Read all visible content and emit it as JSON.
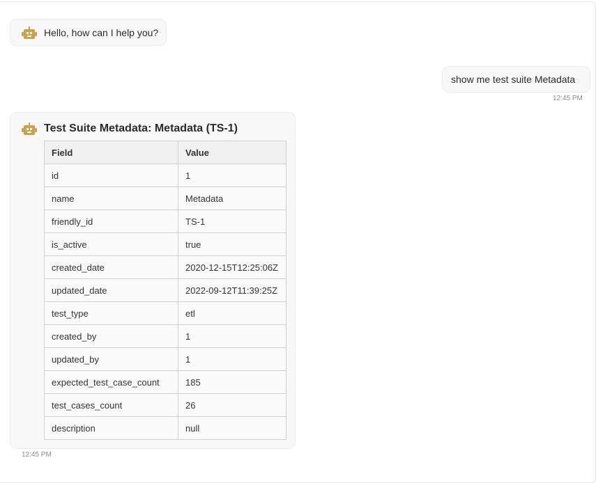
{
  "colors": {
    "bot_icon": "#c9a24a",
    "bubble_bg": "#f8f8f8",
    "table_header_bg": "#f1f1f1"
  },
  "icons": {
    "bot": "robot-icon"
  },
  "messages": {
    "greeting": {
      "text": "Hello, how can I help you?"
    },
    "user": {
      "text": "show me test suite Metadata",
      "time": "12:45 PM"
    },
    "table_reply": {
      "title": "Test Suite Metadata: Metadata (TS-1)",
      "time": "12:45 PM",
      "headers": [
        "Field",
        "Value"
      ],
      "rows": [
        [
          "id",
          "1"
        ],
        [
          "name",
          "Metadata"
        ],
        [
          "friendly_id",
          "TS-1"
        ],
        [
          "is_active",
          "true"
        ],
        [
          "created_date",
          "2020-12-15T12:25:06Z"
        ],
        [
          "updated_date",
          "2022-09-12T11:39:25Z"
        ],
        [
          "test_type",
          "etl"
        ],
        [
          "created_by",
          "1"
        ],
        [
          "updated_by",
          "1"
        ],
        [
          "expected_test_case_count",
          "185"
        ],
        [
          "test_cases_count",
          "26"
        ],
        [
          "description",
          "null"
        ]
      ]
    }
  }
}
